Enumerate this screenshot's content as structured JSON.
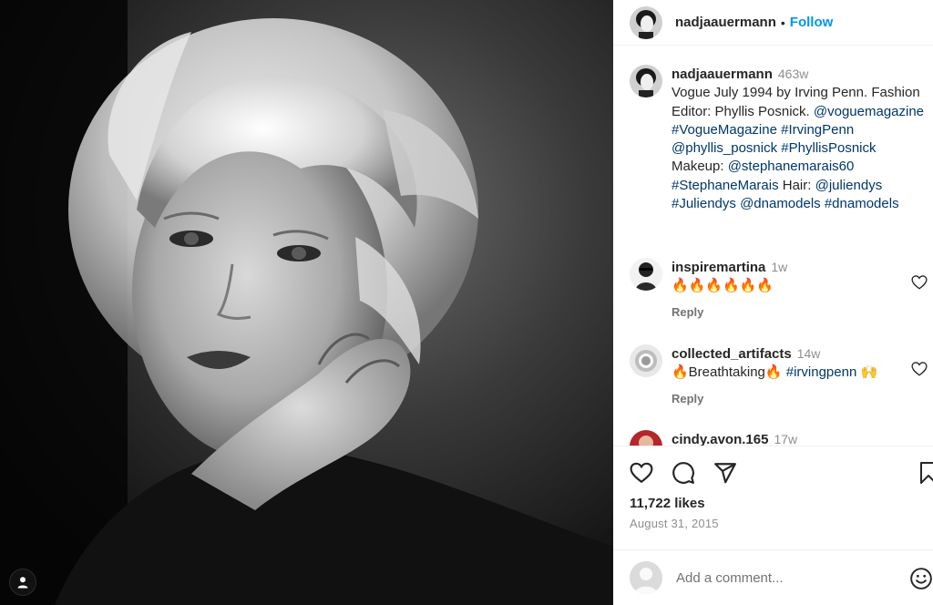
{
  "post": {
    "username": "nadjaauermann",
    "follow_label": "Follow",
    "separator": "•"
  },
  "caption": {
    "username": "nadjaauermann",
    "time": "463w",
    "text_1": "Vogue July 1994 by Irving Penn. Fashion Editor: Phyllis Posnick. ",
    "tag_1": "@voguemagazine",
    "tag_2": "#VogueMagazine",
    "tag_3": "#IrvingPenn",
    "tag_4": "@phyllis_posnick",
    "tag_5": "#PhyllisPosnick",
    "text_2": " Makeup: ",
    "tag_6": "@stephanemarais60",
    "tag_7": "#StephaneMarais",
    "text_3": " Hair: ",
    "tag_8": "@juliendys",
    "tag_9": "#Juliendys",
    "tag_10": "@dnamodels",
    "tag_11": "#dnamodels"
  },
  "comments": [
    {
      "username": "inspiremartina",
      "time": "1w",
      "text": "🔥🔥🔥🔥🔥🔥",
      "reply_label": "Reply"
    },
    {
      "username": "collected_artifacts",
      "time": "14w",
      "text_a": "🔥Breathtaking🔥 ",
      "tag": "#irvingpenn",
      "text_b": " 🙌",
      "reply_label": "Reply"
    },
    {
      "username": "cindy.avon.165",
      "time": "17w"
    }
  ],
  "actions": {
    "like_icon": "heart-icon",
    "comment_icon": "comment-bubble-icon",
    "share_icon": "paper-plane-icon",
    "save_icon": "bookmark-icon"
  },
  "likes_text": "11,722 likes",
  "date_text": "August 31, 2015",
  "add_comment": {
    "placeholder": "Add a comment..."
  },
  "colors": {
    "link": "#00376b",
    "follow": "#0095f6",
    "muted": "#8e8e8e"
  }
}
